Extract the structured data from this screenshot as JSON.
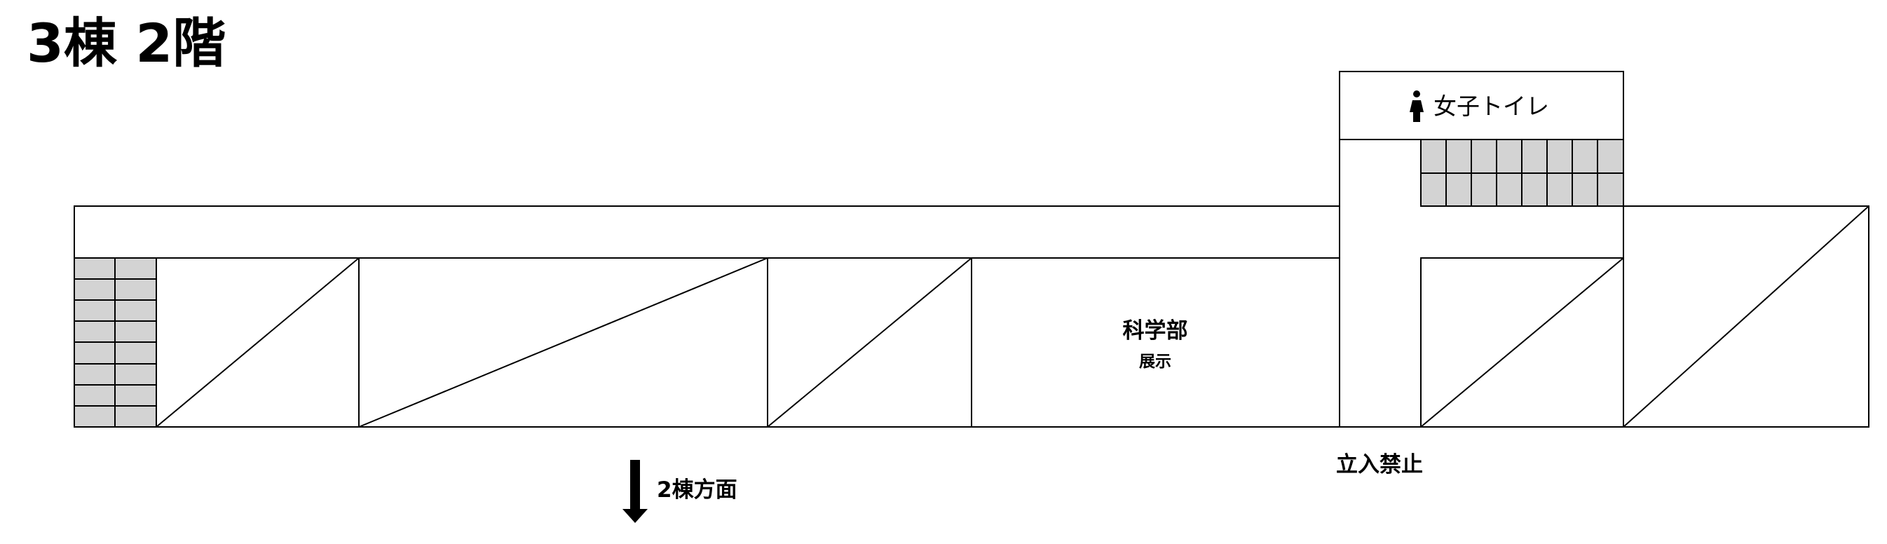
{
  "title": "3棟 2階",
  "rooms": {
    "science": {
      "name": "科学部",
      "sub": "展示"
    },
    "toilet": {
      "name": "女子トイレ",
      "icon": "female-person-icon"
    }
  },
  "no_entry": "立入禁止",
  "direction": {
    "label": "2棟方面",
    "icon": "down-arrow-icon"
  },
  "colors": {
    "line": "#000000",
    "locker": "#d3d3d3",
    "background": "#ffffff"
  }
}
